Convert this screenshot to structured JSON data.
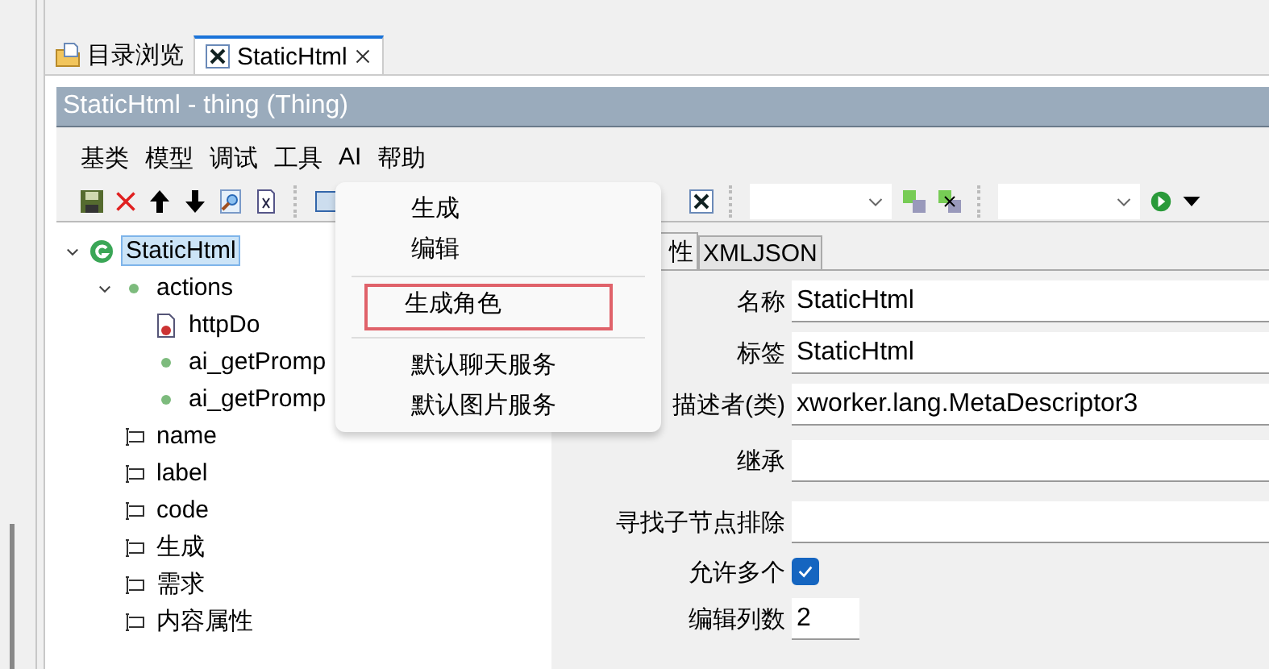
{
  "editor_tabs": [
    {
      "label": "目录浏览",
      "kind": "folder",
      "selected": false,
      "closable": false
    },
    {
      "label": "StaticHtml",
      "kind": "thing",
      "selected": true,
      "closable": true
    }
  ],
  "title_bar": {
    "title": "StaticHtml - thing  (Thing)"
  },
  "menu_bar": [
    "基类",
    "模型",
    "调试",
    "工具",
    "AI",
    "帮助"
  ],
  "tree": [
    {
      "label": "StaticHtml",
      "kind": "root",
      "selected": true,
      "expanded": true,
      "children": [
        {
          "label": "actions",
          "kind": "node",
          "selected": false,
          "expanded": true,
          "children": [
            {
              "label": "httpDo",
              "kind": "doc",
              "selected": false
            },
            {
              "label": "ai_getPromp",
              "kind": "node",
              "selected": false
            },
            {
              "label": "ai_getPromp",
              "kind": "node",
              "selected": false
            }
          ]
        },
        {
          "label": "name",
          "kind": "attribute",
          "selected": false
        },
        {
          "label": "label",
          "kind": "attribute",
          "selected": false
        },
        {
          "label": "code",
          "kind": "attribute",
          "selected": false
        },
        {
          "label": "生成",
          "kind": "attribute",
          "selected": false
        },
        {
          "label": "需求",
          "kind": "attribute",
          "selected": false
        },
        {
          "label": "内容属性",
          "kind": "attribute",
          "selected": false
        }
      ]
    }
  ],
  "form_tabs": [
    {
      "label": "性",
      "selected": true
    },
    {
      "label": "XMLJSON",
      "selected": false
    }
  ],
  "form": [
    {
      "label": "名称",
      "kind": "text",
      "value": "StaticHtml"
    },
    {
      "label": "标签",
      "kind": "text",
      "value": "StaticHtml"
    },
    {
      "label": "描述者(类)",
      "kind": "text",
      "value": "xworker.lang.MetaDescriptor3"
    },
    {
      "label": "继承",
      "kind": "text"
    },
    {
      "label": "寻找子节点排除",
      "kind": "text"
    },
    {
      "label": "允许多个",
      "kind": "checkbox",
      "checked": true
    },
    {
      "label": "编辑列数",
      "kind": "number",
      "value": "2"
    }
  ],
  "context_menu": [
    {
      "label": "生成",
      "kind": "item",
      "selected": false
    },
    {
      "label": "编辑",
      "kind": "item",
      "selected": false
    },
    {
      "kind": "separator"
    },
    {
      "label": "生成角色",
      "kind": "item",
      "selected": true
    },
    {
      "kind": "separator"
    },
    {
      "label": "默认聊天服务",
      "kind": "item",
      "selected": false
    },
    {
      "label": "默认图片服务",
      "kind": "item",
      "selected": false
    }
  ]
}
